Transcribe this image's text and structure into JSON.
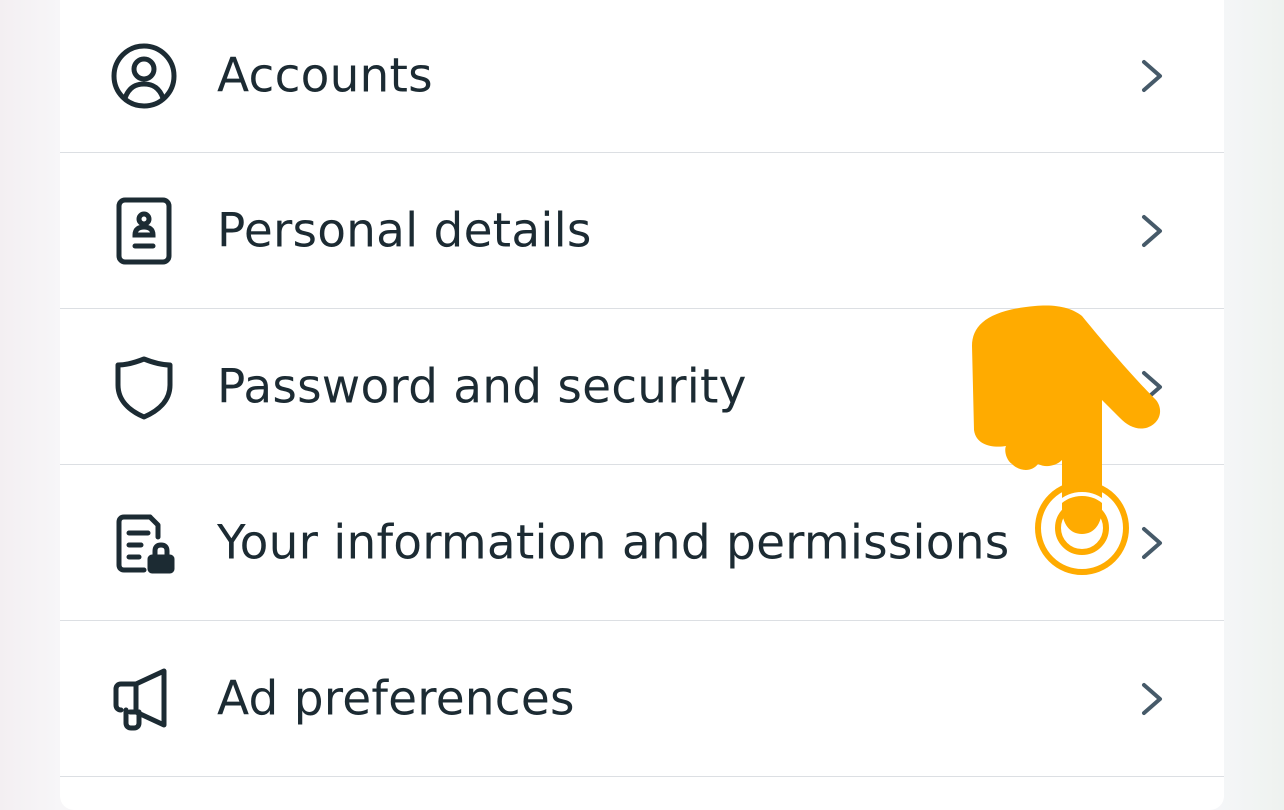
{
  "menu": {
    "items": [
      {
        "label": "Accounts",
        "icon": "person-circle-icon"
      },
      {
        "label": "Personal details",
        "icon": "id-card-icon"
      },
      {
        "label": "Password and security",
        "icon": "shield-icon"
      },
      {
        "label": "Your information and permissions",
        "icon": "document-lock-icon"
      },
      {
        "label": "Ad preferences",
        "icon": "megaphone-icon"
      }
    ],
    "chevron_icon": "chevron-right-icon"
  },
  "overlay": {
    "icon": "pointing-hand-icon",
    "color": "#ffab00"
  },
  "colors": {
    "text": "#1c2b33",
    "icon_stroke": "#1c2b33",
    "chevron": "#465a69",
    "divider": "#dcdfe3",
    "card": "#ffffff"
  }
}
